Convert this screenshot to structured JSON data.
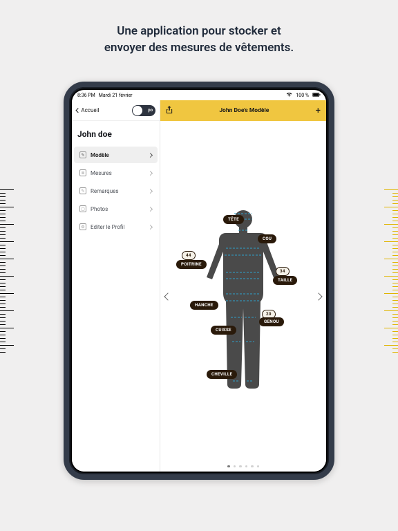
{
  "promo": {
    "line1": "Une application pour stocker et",
    "line2": "envoyer des mesures de vêtements."
  },
  "status": {
    "time": "8:36 PM",
    "date": "Mardi 21 février",
    "battery": "100 %"
  },
  "sidebar": {
    "back_label": "Accueil",
    "unit_toggle": "po",
    "profile_name": "John doe",
    "items": [
      {
        "icon": "template-icon",
        "label": "Modèle",
        "active": true
      },
      {
        "icon": "measurements-icon",
        "label": "Mesures",
        "active": false
      },
      {
        "icon": "notes-icon",
        "label": "Remarques",
        "active": false
      },
      {
        "icon": "photos-icon",
        "label": "Photos",
        "active": false
      },
      {
        "icon": "edit-icon",
        "label": "Editer le Profil",
        "active": false
      }
    ]
  },
  "main": {
    "share_icon": "share-icon",
    "title": "John Doe's Modèle",
    "add_icon": "plus-icon"
  },
  "body_labels": {
    "tete": "TÊTE",
    "cou": "COU",
    "poitrine": "POITRINE",
    "poitrine_val": "44",
    "taille": "TAILLE",
    "taille_val": "34",
    "hanche": "HANCHE",
    "cuisse": "CUISSE",
    "genou": "GENOU",
    "genou_val": "20",
    "cheville": "CHEVILLE"
  },
  "carousel": {
    "pages": 6,
    "active": 0
  },
  "colors": {
    "accent": "#f0c640",
    "frame": "#343c4a"
  }
}
